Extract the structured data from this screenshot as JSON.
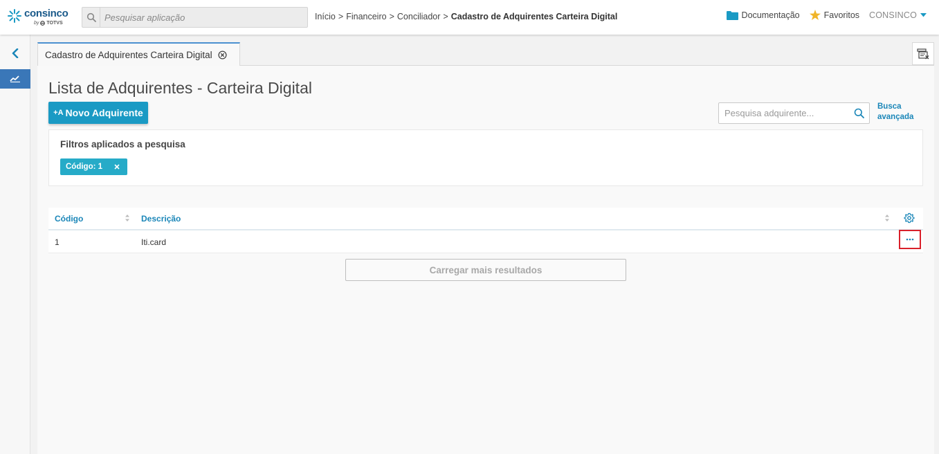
{
  "brand": {
    "name": "consinco",
    "by": "by",
    "company": "TOTVS",
    "mark_color": "#1a9ac4"
  },
  "header": {
    "search_placeholder": "Pesquisar aplicação",
    "breadcrumb": [
      "Início",
      "Financeiro",
      "Conciliador",
      "Cadastro de Adquirentes Carteira Digital"
    ],
    "breadcrumb_separator": ">",
    "documentation_label": "Documentação",
    "favorites_label": "Favoritos",
    "user_label": "CONSINCO"
  },
  "sidebar": {
    "active_item_color": "#3a77b8"
  },
  "tabs": {
    "active_label": "Cadastro de Adquirentes Carteira Digital"
  },
  "page": {
    "title": "Lista de Adquirentes - Carteira Digital",
    "new_button_prefix": "+A",
    "new_button_label": "Novo Adquirente",
    "search_placeholder": "Pesquisa adquirente...",
    "advanced_search_line1": "Busca",
    "advanced_search_line2": "avançada",
    "filters_title": "Filtros aplicados a pesquisa",
    "filter_chip_label": "Código: 1",
    "load_more_label": "Carregar mais resultados"
  },
  "table": {
    "columns": [
      "Código",
      "Descrição"
    ],
    "rows": [
      {
        "codigo": "1",
        "descricao": "Iti.card"
      }
    ]
  },
  "colors": {
    "primary_button": "#1a9ac4",
    "link": "#1a86b8",
    "chip": "#26abc8",
    "highlight_border": "#d9202a",
    "tab_accent": "#4a90d0"
  }
}
